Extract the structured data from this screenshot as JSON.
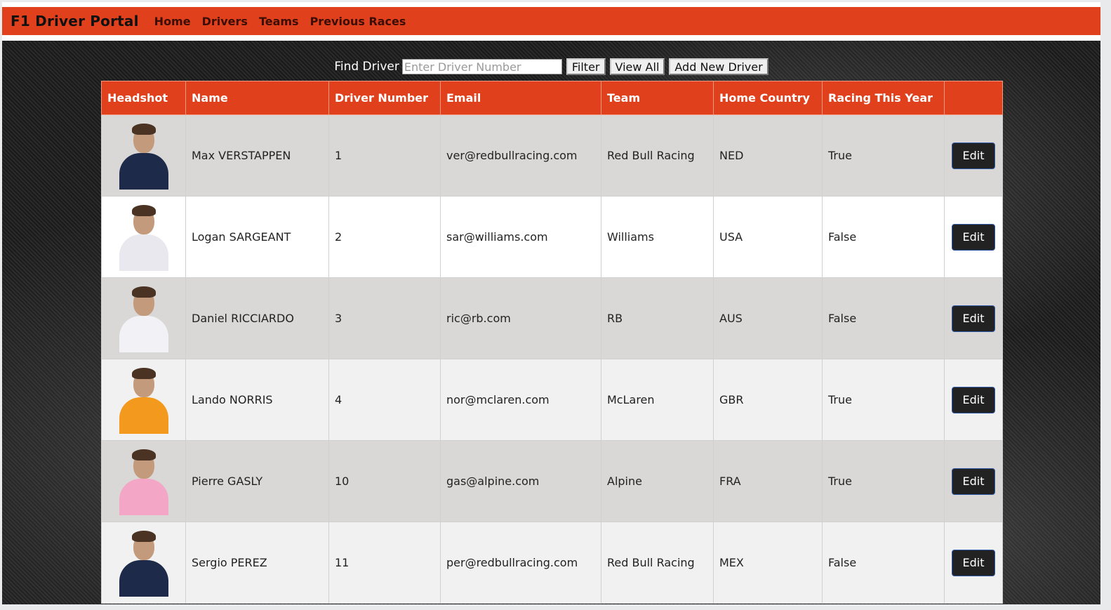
{
  "nav": {
    "brand": "F1 Driver Portal",
    "links": [
      "Home",
      "Drivers",
      "Teams",
      "Previous Races"
    ]
  },
  "filter": {
    "label": "Find Driver",
    "placeholder": "Enter Driver Number",
    "value": "",
    "filter_button": "Filter",
    "view_all_button": "View All",
    "add_button": "Add New Driver"
  },
  "table": {
    "headers": [
      "Headshot",
      "Name",
      "Driver Number",
      "Email",
      "Team",
      "Home Country",
      "Racing This Year",
      ""
    ],
    "rows": [
      {
        "name": "Max VERSTAPPEN",
        "number": "1",
        "email": "ver@redbullracing.com",
        "team": "Red Bull Racing",
        "country": "NED",
        "racing": "True",
        "edit": "Edit",
        "suit_color": "#1e2a4a"
      },
      {
        "name": "Logan SARGEANT",
        "number": "2",
        "email": "sar@williams.com",
        "team": "Williams",
        "country": "USA",
        "racing": "False",
        "edit": "Edit",
        "suit_color": "#e8e8ee"
      },
      {
        "name": "Daniel RICCIARDO",
        "number": "3",
        "email": "ric@rb.com",
        "team": "RB",
        "country": "AUS",
        "racing": "False",
        "edit": "Edit",
        "suit_color": "#f2f2f6"
      },
      {
        "name": "Lando NORRIS",
        "number": "4",
        "email": "nor@mclaren.com",
        "team": "McLaren",
        "country": "GBR",
        "racing": "True",
        "edit": "Edit",
        "suit_color": "#f39a1e"
      },
      {
        "name": "Pierre GASLY",
        "number": "10",
        "email": "gas@alpine.com",
        "team": "Alpine",
        "country": "FRA",
        "racing": "True",
        "edit": "Edit",
        "suit_color": "#f3a6c6"
      },
      {
        "name": "Sergio PEREZ",
        "number": "11",
        "email": "per@redbullracing.com",
        "team": "Red Bull Racing",
        "country": "MEX",
        "racing": "False",
        "edit": "Edit",
        "suit_color": "#1e2a4a"
      }
    ]
  },
  "colors": {
    "accent": "#e0401c",
    "row_gray": "#d9d8d7",
    "row_light": "#f1f1f1",
    "button_dark": "#222222"
  }
}
